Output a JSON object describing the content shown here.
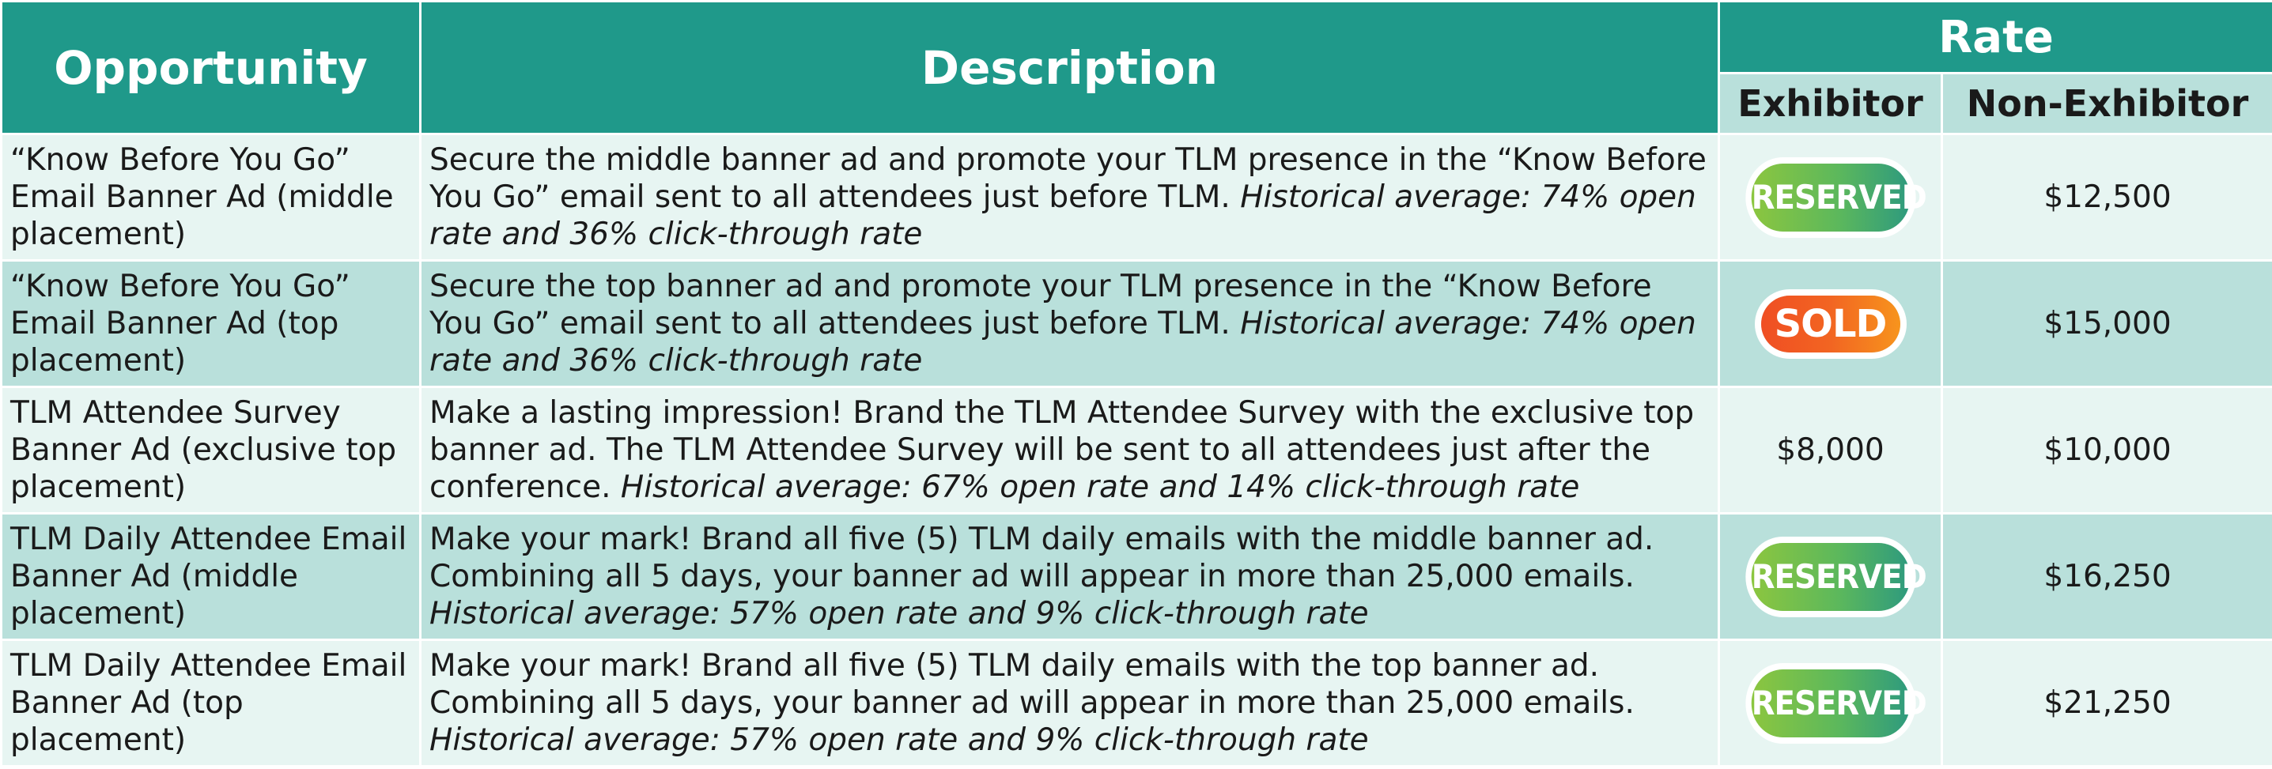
{
  "header": {
    "opportunity": "Opportunity",
    "description": "Description",
    "rate": "Rate",
    "exhibitor": "Exhibitor",
    "non_exhibitor": "Non-Exhibitor"
  },
  "rows": [
    {
      "opportunity": "“Know Before You Go” Email Banner Ad (middle placement)",
      "description": "Secure the middle banner ad and promote your TLM presence in the “Know Before You Go” email sent to all attendees just before TLM. ",
      "description_italic": "Historical average: 74% open rate and 36% click-through rate",
      "exhibitor": "RESERVED",
      "non_exhibitor": "$12,500"
    },
    {
      "opportunity": "“Know Before You Go” Email Banner Ad (top placement)",
      "description": "Secure the top banner ad and promote your TLM presence in the “Know Before You Go” email sent to all attendees just before TLM. ",
      "description_italic": "Historical average: 74% open rate and 36% click-through rate",
      "exhibitor": "SOLD",
      "non_exhibitor": "$15,000"
    },
    {
      "opportunity": "TLM Attendee Survey Banner Ad (exclusive top placement)",
      "description": "Make a lasting impression! Brand the TLM Attendee Survey with the exclusive top banner ad. The TLM Attendee Survey will be sent to all attendees just after the conference. ",
      "description_italic": "Historical average: 67% open rate and 14% click-through rate",
      "exhibitor": "$8,000",
      "non_exhibitor": "$10,000"
    },
    {
      "opportunity": "TLM Daily Attendee Email Banner Ad (middle placement)",
      "description": "Make your mark! Brand all five (5) TLM daily emails with the middle banner ad. Combining all 5 days, your banner ad will appear in more than 25,000 emails. ",
      "description_italic": "Historical average: 57% open rate and 9% click-through rate",
      "exhibitor": "RESERVED",
      "non_exhibitor": "$16,250"
    },
    {
      "opportunity": "TLM Daily Attendee Email Banner Ad (top placement)",
      "description": "Make your mark! Brand all five (5) TLM daily emails with the top banner ad. Combining all 5 days, your banner ad will appear in more than 25,000 emails. ",
      "description_italic": "Historical average: 57% open rate and 9% click-through rate",
      "exhibitor": "RESERVED",
      "non_exhibitor": "$21,250"
    }
  ],
  "colors": {
    "header": "#1f998a",
    "subheader": "#b9e0db",
    "row_light": "#e7f5f2",
    "row_dark": "#b9e0db",
    "reserved_badge": "#8cc63f",
    "sold_badge": "#f26522"
  }
}
